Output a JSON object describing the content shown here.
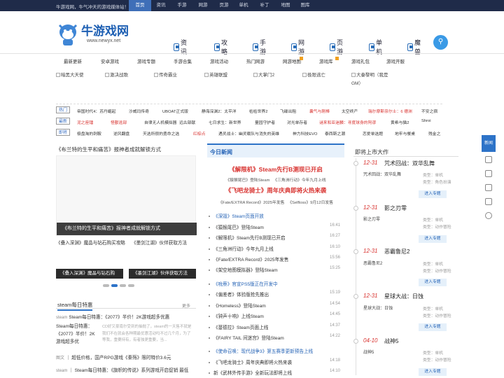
{
  "topbar": {
    "slogan": "牛游戏网，牛气冲天的游戏媒体站！",
    "links": [
      "首页",
      "资讯",
      "手游",
      "网游",
      "页游",
      "单机",
      "补丁",
      "地图",
      "图库"
    ]
  },
  "logo": {
    "brand": "牛游戏网",
    "url": "www.newyx.net"
  },
  "nav": [
    "资讯",
    "攻略",
    "手游",
    "网游",
    "页游",
    "单机",
    "魔兽"
  ],
  "subnav": [
    "最新更新",
    "安卓游戏",
    "游戏专题",
    "手游合集",
    "游戏活动",
    "热门网游",
    "网游地图",
    "游戏库",
    "游戏礼包",
    "游戏开服"
  ],
  "thumbs": [
    "暗黑大天使",
    "激决战歌",
    "传奇霸业",
    "英雄联盟",
    "大掌门2",
    "极限逃亡",
    "大秦黎明（我是",
    "GM）"
  ],
  "keywords": {
    "row1": {
      "tag": "热门",
      "items": [
        "帝国时代4：苏丹崛起",
        "沙威玛传奇",
        "UBOAT正式版",
        "静海深渊2：太平洋",
        "枯枯世界2",
        "飞碟出租",
        "囊气与刚棒",
        "太空终产",
        "瑞尔摩斯奈尔士：6 德洲",
        "不安之宿"
      ]
    },
    "row2": {
      "tag": "最新",
      "items": [
        "泥之座镭",
        "怪獸逃部",
        "自律无人机模拟器",
        "远古部献",
        "七日求生：新世界",
        "量园守护者",
        "对光单存者",
        "谜来和亚迷麟：寻度球身的阿谬",
        "黄希与猫2",
        "Shroi"
      ]
    },
    "row3": {
      "tag": "即将",
      "items": [
        "极盘淘的刺鞍",
        "逆风翻盘",
        "天选所很的勇命之选",
        "红棕点",
        "遇灵战士：幽灵载队与消失的英雄",
        "神力科技EVO",
        "泰西斯之潮",
        "恋爱单选题",
        "地牢与餐桌",
        "残金之"
      ]
    }
  },
  "left": {
    "top_title": "《布兰特的生平和痛苦》报神者成就解锁方式",
    "big_caption": "《布兰特的生平和痛苦》报神者成就解锁方式",
    "pic_links": [
      "《叠入深渊》魔晶与钻石购买攻略",
      "《墨剑江湖》伙伴获取方法"
    ],
    "bar1": "《叠入深渊》魔晶与钻石购",
    "bar2": "《墨剑江湖》伙伴获取方法",
    "steam_title": "steam每日特惠",
    "more": "更多",
    "steam_items": [
      {
        "cat": "steam",
        "text": "Steam每日特惠：《2077》半价！2K游戏超多优惠"
      },
      {
        "cat": "",
        "text": "Steam每日特惠：《2077》半价！2K游戏超多优"
      },
      {
        "cat": "图文",
        "text": "超低价格，国产RPG游戏《秦殇》限时特价3.6元"
      },
      {
        "cat": "steam",
        "text": "Steam每日特惠：《旗帜的传说》系列游戏开启促销 最低"
      }
    ],
    "steam_desc": "CD好又豪南尔受到的抽抛了，steam的一天售不就是我们不在就会各种期最优惠活动吗不过几个月，为了等我，重要持有，有者独更重要，当..."
  },
  "mid": {
    "title": "今日新闻",
    "hl1": "《解限机》Steam先行B测现已开启",
    "hl1_sub": [
      "《猿猴尾巴》登陆Steam",
      "《三角洲行动》今年九月上线"
    ],
    "hl2": "《飞吧龙骑士》周年庆典即将火热来袭",
    "hl2_sub": [
      "《Fate/EXTRA Record》2025年发售",
      "《Selfloss》9月12日发售"
    ],
    "group1": [
      {
        "t": "《深毁》Steam页面开放",
        "d": "",
        "blue": true
      },
      {
        "t": "《猿猴尾巴》登陆Steam",
        "d": "16:41"
      },
      {
        "t": "《解限机》Steam先行B测现已开启",
        "d": "16:27"
      },
      {
        "t": "《三角洲行动》今年九月上线",
        "d": "16:10"
      },
      {
        "t": "《Fate/EXTRA Record》2025年发售",
        "d": "15:56"
      },
      {
        "t": "《架空地图模拟器》登陆Steam",
        "d": "15:25"
      }
    ],
    "group2": [
      {
        "t": "《吮蔡》官宣PS5版正在开发中",
        "d": "",
        "blue": true
      },
      {
        "t": "《偏差者》体验版抢先推出",
        "d": "15:19"
      },
      {
        "t": "《Homeless》登陆Steam",
        "d": "14:54"
      },
      {
        "t": "《钟声十响》上线Steam",
        "d": "14:45"
      },
      {
        "t": "《蔓德拉》Steam页面上线",
        "d": "14:37"
      },
      {
        "t": "《FAIRY TAIL 间迷宫》登陆Steam",
        "d": "14:22"
      }
    ],
    "group3": [
      {
        "t": "《使命召唤：现代战争3》第五赛季更新预告上线",
        "d": "",
        "blue": true
      },
      {
        "t": "《飞吧龙骑士》周年庆典即将火热来袭",
        "d": "14:18"
      },
      {
        "t": "新《武林外传手游》全新玩法即将上线",
        "d": "14:10"
      }
    ]
  },
  "right": {
    "title": "即将上市大作",
    "items": [
      {
        "date": "12-31",
        "name": "咒术回战：双华乱舞",
        "thumb": "咒术回战：双华乱舞",
        "type": "类型：单机",
        "cat": "类型：角色扮演",
        "btn": "进入专题"
      },
      {
        "date": "12-31",
        "name": "影之刃零",
        "thumb": "影之刃零",
        "type": "类型：单机",
        "cat": "类型：动作冒险",
        "btn": "进入专题"
      },
      {
        "date": "12-31",
        "name": "恶霸鲁尼2",
        "thumb": "恶霸鲁尼2",
        "type": "类型：单机",
        "cat": "类型：动作冒险",
        "btn": "进入专题"
      },
      {
        "date": "12-31",
        "name": "星球大战：日蚀",
        "thumb": "星球大战：日蚀",
        "type": "类型：单机",
        "cat": "类型：动作冒险",
        "btn": "进入专题"
      },
      {
        "date": "04-10",
        "name": "战神5",
        "thumb": "战神5",
        "type": "类型：单机",
        "cat": "类型：动作冒险",
        "btn": "进入专题"
      }
    ]
  },
  "sidebar": {
    "top": "新闻"
  }
}
